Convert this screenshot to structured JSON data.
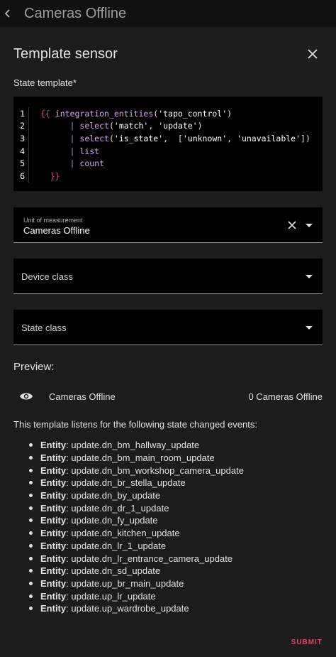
{
  "topbar": {
    "title": "Cameras Offline"
  },
  "dialog": {
    "title": "Template sensor",
    "state_template_label": "State template*",
    "code_lines": [
      {
        "n": "1",
        "parts": [
          {
            "t": "{{ ",
            "c": "c-brace"
          },
          {
            "t": "integration_entities",
            "c": "c-fn"
          },
          {
            "t": "(",
            "c": "c-punc"
          },
          {
            "t": "'tapo_control'",
            "c": "c-str"
          },
          {
            "t": ")",
            "c": "c-punc"
          }
        ]
      },
      {
        "n": "2",
        "parts": [
          {
            "t": "      ",
            "c": "c-punc"
          },
          {
            "t": "| ",
            "c": "c-pipe"
          },
          {
            "t": "select",
            "c": "c-fn"
          },
          {
            "t": "(",
            "c": "c-punc"
          },
          {
            "t": "'match'",
            "c": "c-str"
          },
          {
            "t": ", ",
            "c": "c-punc"
          },
          {
            "t": "'update'",
            "c": "c-str"
          },
          {
            "t": ")",
            "c": "c-punc"
          }
        ]
      },
      {
        "n": "3",
        "parts": [
          {
            "t": "      ",
            "c": "c-punc"
          },
          {
            "t": "| ",
            "c": "c-pipe"
          },
          {
            "t": "select",
            "c": "c-fn"
          },
          {
            "t": "(",
            "c": "c-punc"
          },
          {
            "t": "'is_state'",
            "c": "c-str"
          },
          {
            "t": ",  [",
            "c": "c-punc"
          },
          {
            "t": "'unknown'",
            "c": "c-str"
          },
          {
            "t": ", ",
            "c": "c-punc"
          },
          {
            "t": "'unavailable'",
            "c": "c-str"
          },
          {
            "t": "])",
            "c": "c-punc"
          }
        ]
      },
      {
        "n": "4",
        "parts": [
          {
            "t": "      ",
            "c": "c-punc"
          },
          {
            "t": "| ",
            "c": "c-pipe"
          },
          {
            "t": "list",
            "c": "c-fn"
          }
        ]
      },
      {
        "n": "5",
        "parts": [
          {
            "t": "      ",
            "c": "c-punc"
          },
          {
            "t": "| ",
            "c": "c-pipe"
          },
          {
            "t": "count",
            "c": "c-fn"
          }
        ]
      },
      {
        "n": "6",
        "parts": [
          {
            "t": "  }}",
            "c": "c-brace"
          }
        ]
      }
    ],
    "unit": {
      "label": "Unit of measurement",
      "value": "Cameras Offline"
    },
    "device_class": {
      "placeholder": "Device class"
    },
    "state_class": {
      "placeholder": "State class"
    },
    "preview": {
      "label": "Preview:",
      "name": "Cameras Offline",
      "state": "0 Cameras Offline"
    },
    "listens_text": "This template listens for the following state changed events:",
    "entity_prefix": "Entity",
    "entities": [
      "update.dn_bm_hallway_update",
      "update.dn_bm_main_room_update",
      "update.dn_bm_workshop_camera_update",
      "update.dn_br_stella_update",
      "update.dn_by_update",
      "update.dn_dr_1_update",
      "update.dn_fy_update",
      "update.dn_kitchen_update",
      "update.dn_lr_1_update",
      "update.dn_lr_entrance_camera_update",
      "update.dn_sd_update",
      "update.up_br_main_update",
      "update.up_lr_update",
      "update.up_wardrobe_update"
    ],
    "submit_label": "SUBMIT"
  }
}
